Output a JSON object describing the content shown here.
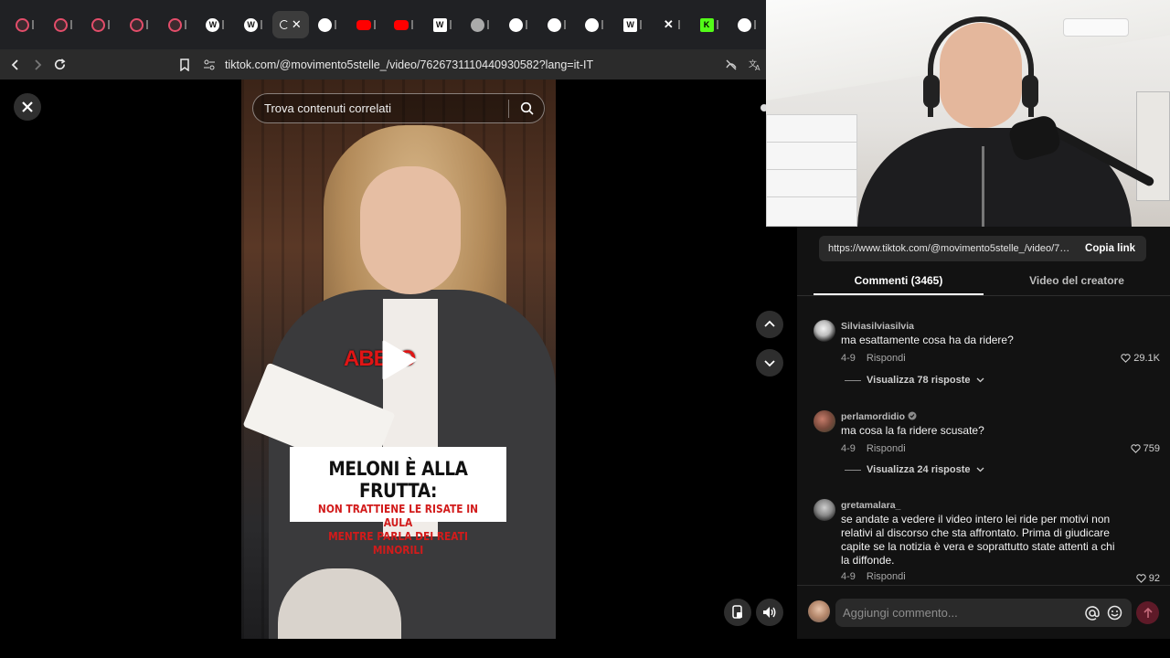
{
  "browser": {
    "tabs": [
      {
        "icon": "tiktok-icon",
        "color": "#e34d6a"
      },
      {
        "icon": "tiktok-icon",
        "color": "#e34d6a"
      },
      {
        "icon": "tiktok-icon",
        "color": "#e34d6a"
      },
      {
        "icon": "tiktok-icon",
        "color": "#e34d6a"
      },
      {
        "icon": "tiktok-icon",
        "color": "#e34d6a"
      },
      {
        "icon": "wordpress-icon",
        "color": "#ffffff"
      },
      {
        "icon": "wordpress-icon",
        "color": "#ffffff"
      },
      {
        "icon": "active-tab",
        "color": "#ffffff"
      },
      {
        "icon": "cursor-icon",
        "color": "#ffffff"
      },
      {
        "icon": "youtube-icon",
        "color": "#ff0000"
      },
      {
        "icon": "youtube-icon",
        "color": "#ff0000"
      },
      {
        "icon": "wikipedia-icon",
        "color": "#ffffff"
      },
      {
        "icon": "globe-icon",
        "color": "#aaaaaa"
      },
      {
        "icon": "chatgpt-icon",
        "color": "#ffffff"
      },
      {
        "icon": "chatgpt-icon",
        "color": "#ffffff"
      },
      {
        "icon": "chatgpt-icon",
        "color": "#ffffff"
      },
      {
        "icon": "wikipedia-icon",
        "color": "#ffffff"
      },
      {
        "icon": "x-icon",
        "color": "#ffffff"
      },
      {
        "icon": "kick-icon",
        "color": "#53fc18"
      },
      {
        "icon": "openai-icon",
        "color": "#ffffff"
      }
    ],
    "url": "tiktok.com/@movimento5stelle_/video/7626731110440930582?lang=it-IT"
  },
  "video": {
    "search_placeholder": "Trova contenuti correlati",
    "overlay_word": "ABB   IO",
    "caption_line1": "MELONI È ALLA FRUTTA:",
    "caption_line2": "NON TRATTIENE LE RISATE IN AULA",
    "caption_line3": "MENTRE PARLA DEI REATI MINORILI"
  },
  "panel": {
    "link": "https://www.tiktok.com/@movimento5stelle_/video/76...",
    "copy_label": "Copia link",
    "tab_comments": "Commenti (3465)",
    "tab_creator": "Video del creatore",
    "comments": [
      {
        "username": "Silviasilviasilvia",
        "text": "ma esattamente cosa ha da ridere?",
        "date": "4-9",
        "reply": "Rispondi",
        "likes": "29.1K",
        "view_replies": "Visualizza 78 risposte"
      },
      {
        "username": "perlamordidio",
        "text": "ma cosa la fa ridere scusate?",
        "date": "4-9",
        "reply": "Rispondi",
        "likes": "759",
        "view_replies": "Visualizza 24 risposte"
      },
      {
        "username": "gretamalara_",
        "text": "se andate a vedere il video intero lei ride per motivi non relativi al discorso che sta affrontato. Prima di giudicare capite se la notizia è vera e soprattutto state attenti a chi la diffonde.",
        "date": "4-9",
        "reply": "Rispondi",
        "likes": "92"
      }
    ],
    "input_placeholder": "Aggiungi commento..."
  },
  "colors": {
    "accent": "#fe2c55",
    "send_button": "#5e1a28"
  }
}
